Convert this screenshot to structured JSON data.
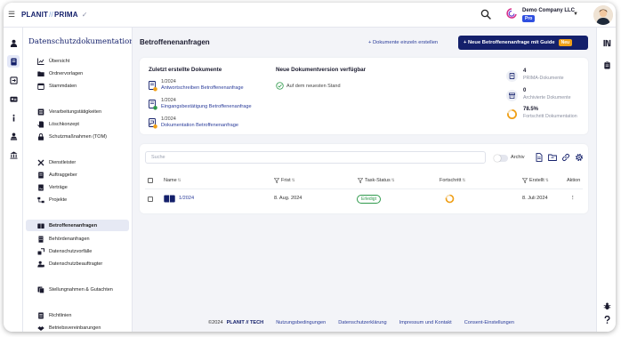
{
  "header": {
    "logo_left": "PLANIT",
    "logo_sep": "//",
    "logo_right": "PRIMA",
    "company": "Demo Company LLC",
    "plan_badge": "Pro"
  },
  "sidebar": {
    "title": "Datenschutzdokumentation",
    "items": [
      {
        "label": "Übersicht",
        "icon": "chart-icon"
      },
      {
        "label": "Ordnervorlagen",
        "icon": "folder-icon"
      },
      {
        "label": "Stammdaten",
        "icon": "calendar-icon"
      },
      {
        "label": "Verarbeitungstätigkeiten",
        "icon": "list-icon"
      },
      {
        "label": "Löschkonzept",
        "icon": "delete-doc-icon"
      },
      {
        "label": "Schutzmaßnahmen (TOM)",
        "icon": "lock-icon"
      },
      {
        "label": "Dienstleister",
        "icon": "tools-icon"
      },
      {
        "label": "Auftraggeber",
        "icon": "document-icon"
      },
      {
        "label": "Verträge",
        "icon": "contract-icon"
      },
      {
        "label": "Projekte",
        "icon": "project-icon"
      },
      {
        "label": "Betroffenenanfragen",
        "icon": "requests-icon"
      },
      {
        "label": "Behördenanfragen",
        "icon": "building-icon"
      },
      {
        "label": "Datenschutzvorfälle",
        "icon": "incident-icon"
      },
      {
        "label": "Datenschutzbeauftragter",
        "icon": "person-icon"
      },
      {
        "label": "Stellungnahmen & Gutachten",
        "icon": "opinion-icon"
      },
      {
        "label": "Richtlinien",
        "icon": "guideline-icon"
      },
      {
        "label": "Betriebsvereinbarungen",
        "icon": "agreement-icon"
      }
    ]
  },
  "main": {
    "title": "Betroffenenanfragen",
    "add_single_label": "+ Dokumente einzeln erstellen",
    "guide_button_label": "+ Neue Betroffenenanfrage mit Guide",
    "guide_badge": "Neu"
  },
  "recent": {
    "heading": "Zuletzt erstellte Dokumente",
    "docs": [
      {
        "number": "1/2024",
        "title": "Antwortschreiben Betroffenenanfrage"
      },
      {
        "number": "1/2024",
        "title": "Eingangsbestätigung Betroffenenanfrage"
      },
      {
        "number": "1/2024",
        "title": "Dokumentation Betroffenenanfrage"
      }
    ]
  },
  "version": {
    "heading": "Neue Dokumentversion verfügbar",
    "status": "Auf dem neuesten Stand"
  },
  "stats": [
    {
      "value": "4",
      "label": "PRIMA-Dokumente",
      "icon": "document-icon"
    },
    {
      "value": "0",
      "label": "Archivierte Dokumente",
      "icon": "archive-icon"
    },
    {
      "value": "78.5%",
      "label": "Fortschritt Dokumentation",
      "icon": "progress-ring-icon",
      "progress": 0.785
    }
  ],
  "table": {
    "search_placeholder": "Suche",
    "archive_label": "Archiv",
    "columns": [
      "Name",
      "Frist",
      "Task-Status",
      "Fortschritt",
      "Erstellt",
      "Aktion"
    ],
    "rows": [
      {
        "name": "1/2024",
        "frist": "8. Aug. 2024",
        "status": "Erledigt",
        "progress": 0.785,
        "erstellt": "8. Juli 2024",
        "action": "⋮"
      }
    ]
  },
  "footer": {
    "copyright": "©2024",
    "brand": "PLANIT // TECH",
    "links": [
      "Nutzungsbedingungen",
      "Datenschutzerklärung",
      "Impressum und Kontakt",
      "Consent-Einstellungen"
    ]
  },
  "colors": {
    "brand_navy": "#14206b",
    "accent_blue": "#2f4fe0",
    "badge_orange": "#f0a018",
    "success_green": "#2f9a4c",
    "progress_orange": "#f0a018"
  }
}
